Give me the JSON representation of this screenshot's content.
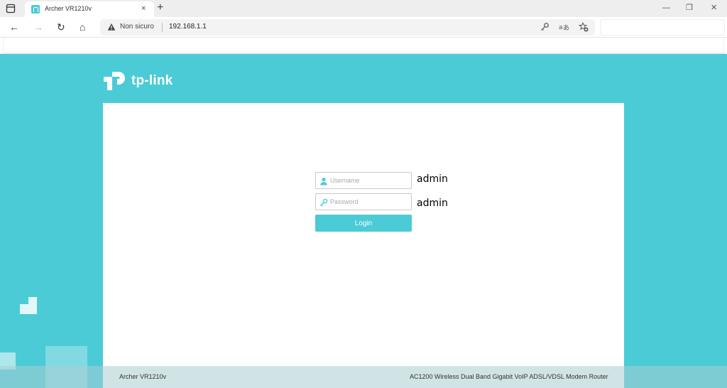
{
  "browser": {
    "tab": {
      "title": "Archer VR1210v",
      "close_glyph": "×"
    },
    "new_tab_glyph": "+",
    "window_controls": {
      "minimize": "—",
      "restore": "❐",
      "close": "✕"
    },
    "nav": {
      "back": "←",
      "forward": "→",
      "reload": "↻",
      "home": "⌂"
    },
    "address": {
      "security_label": "Non sicuro",
      "url": "192.168.1.1",
      "icons": [
        "key-icon",
        "translate-icon",
        "favorite-add-icon"
      ]
    }
  },
  "router_page": {
    "brand": "tp-link",
    "login": {
      "username_placeholder": "Username",
      "password_placeholder": "Password",
      "button_label": "Login"
    },
    "annotations": {
      "username_hint": "admin",
      "password_hint": "admin"
    },
    "footer": {
      "model": "Archer VR1210v",
      "description": "AC1200 Wireless Dual Band Gigabit VoIP ADSL/VDSL Modem Router"
    }
  },
  "colors": {
    "brand": "#4bcbd6",
    "panel": "#ffffff"
  }
}
